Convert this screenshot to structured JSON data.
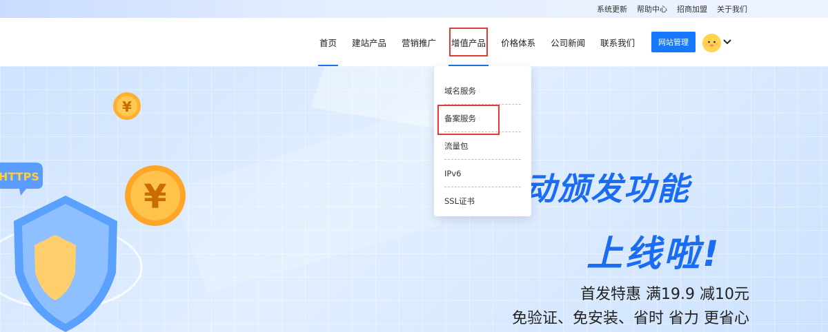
{
  "topbar": {
    "links": [
      "系统更新",
      "帮助中心",
      "招商加盟",
      "关于我们"
    ]
  },
  "nav": {
    "items": [
      "首页",
      "建站产品",
      "营销推广",
      "增值产品",
      "价格体系",
      "公司新闻",
      "联系我们"
    ],
    "admin_button": "网站管理"
  },
  "dropdown": {
    "items": [
      "域名服务",
      "备案服务",
      "流量包",
      "IPv6",
      "SSL证书"
    ]
  },
  "hero": {
    "https_badge": "HTTPS",
    "currency_symbol": "¥",
    "title_line1": "动颁发功能",
    "title_line2": "上线啦!",
    "subtitle1": "首发特惠 满19.9 减10元",
    "subtitle2": "免验证、免安装、省时 省力 更省心"
  },
  "colors": {
    "accent": "#1677ff",
    "highlight": "#e53935",
    "hero_text": "#1a6cf2"
  }
}
